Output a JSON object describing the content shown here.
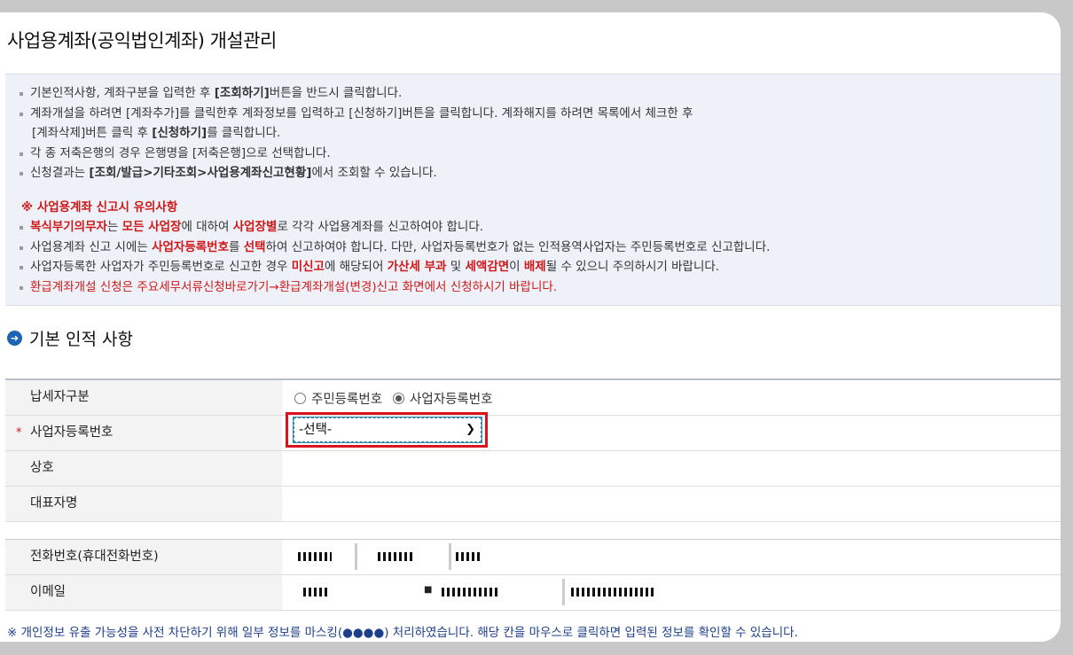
{
  "page": {
    "title": "사업용계좌(공익법인계좌) 개설관리"
  },
  "notice": {
    "l1_pre": "기본인적사항, 계좌구분을 입력한 후 ",
    "l1_bold": "[조회하기]",
    "l1_post": "버튼을 반드시 클릭합니다.",
    "l2": "계좌개설을 하려면 [계좌추가]를 클릭한후 계좌정보를 입력하고 [신청하기]버튼을 클릭합니다. 계좌해지를 하려면 목록에서 체크한 후",
    "l3_pre": "[계좌삭제]버튼 클릭 후 ",
    "l3_bold": "[신청하기]",
    "l3_post": "를 클릭합니다.",
    "l4": "각 종 저축은행의 경우 은행명을 [저축은행]으로 선택합니다.",
    "l5_pre": "신청결과는 ",
    "l5_bold": "[조회/발급>기타조회>사업용계좌신고현황]",
    "l5_post": "에서 조회할 수 있습니다.",
    "warn_title": "※ 사업용계좌 신고시 유의사항",
    "w1_a": "복식부기의무자",
    "w1_b": "는 ",
    "w1_c": "모든 사업장",
    "w1_d": "에 대하여 ",
    "w1_e": "사업장별",
    "w1_f": "로 각각 사업용계좌를 신고하여야 합니다.",
    "w2_a": "사업용계좌 신고 시에는 ",
    "w2_b": "사업자등록번호",
    "w2_c": "를 ",
    "w2_d": "선택",
    "w2_e": "하여 신고하여야 합니다. 다만, 사업자등록번호가 없는 인적용역사업자는 주민등록번호로 신고합니다.",
    "w3_a": "사업자등록한 사업자가 주민등록번호로 신고한 경우 ",
    "w3_b": "미신고",
    "w3_c": "에 해당되어 ",
    "w3_d": "가산세 부과",
    "w3_e": " 및 ",
    "w3_f": "세액감면",
    "w3_g": "이 ",
    "w3_h": "배제",
    "w3_i": "될 수 있으니 주의하시기 바랍니다.",
    "w4": "환급계좌개설 신청은 주요세무서류신청바로가기→환급계좌개설(변경)신고 화면에서 신청하시기 바랍니다."
  },
  "section": {
    "title": "기본 인적 사항"
  },
  "form": {
    "taxpayer_type_label": "납세자구분",
    "radio_resident": "주민등록번호",
    "radio_business": "사업자등록번호",
    "selected_radio": "business",
    "bizno_label": "사업자등록번호",
    "required_mark": "*",
    "bizno_select_value": "-선택-",
    "company_label": "상호",
    "ceo_label": "대표자명",
    "phone_label": "전화번호(휴대전화번호)",
    "email_label": "이메일",
    "email_at": "■"
  },
  "footnote": "※ 개인정보 유출 가능성을 사전 차단하기 위해 일부 정보를 마스킹(●●●●) 처리하였습니다. 해당 칸을 마우스로 클릭하면 입력된 정보를 확인할 수 있습니다.",
  "colors": {
    "accent_red": "#d01818",
    "highlight_border": "#d9141e",
    "section_icon": "#1e64b4",
    "footnote": "#1c3f8a"
  }
}
